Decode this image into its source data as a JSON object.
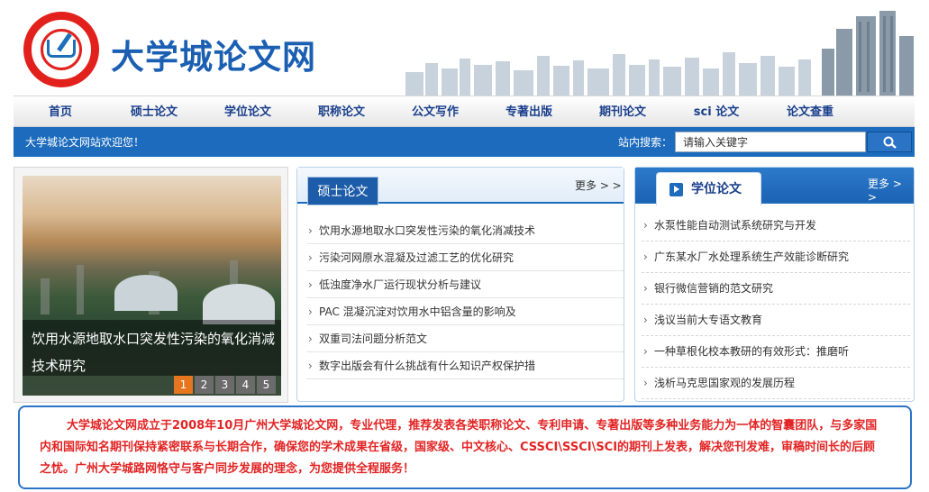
{
  "header": {
    "site_title": "大学城论文网",
    "logo_icon": "book-pen-logo-icon"
  },
  "nav": {
    "items": [
      "首页",
      "硕士论文",
      "学位论文",
      "职称论文",
      "公文写作",
      "专著出版",
      "期刊论文",
      "sci 论文",
      "论文查重"
    ]
  },
  "bar": {
    "welcome": "大学城论文网站欢迎您！",
    "search_label": "站内搜索：",
    "search_placeholder": "请输入关键字"
  },
  "slider": {
    "caption": "饮用水源地取水口突发性污染的氧化消减技术研究",
    "pages": [
      "1",
      "2",
      "3",
      "4",
      "5"
    ],
    "active_page": "1"
  },
  "box1": {
    "title": "硕士论文",
    "more": "更多 > >",
    "items": [
      "饮用水源地取水口突发性污染的氧化消减技术",
      "污染河网原水混凝及过滤工艺的优化研究",
      "低浊度净水厂运行现状分析与建议",
      "PAC 混凝沉淀对饮用水中铝含量的影响及",
      "双重司法问题分析范文",
      "数字出版会有什么挑战有什么知识产权保护措"
    ]
  },
  "box2": {
    "title": "学位论文",
    "more": "更多 > >",
    "items": [
      "水泵性能自动测试系统研究与开发",
      "广东某水厂水处理系统生产效能诊断研究",
      "银行微信营销的范文研究",
      "浅议当前大专语文教育",
      "一种草根化校本教研的有效形式：推磨听",
      "浅析马克思国家观的发展历程"
    ]
  },
  "intro": {
    "text": "大学城论文网成立于2008年10月广州大学城论文网，专业代理，推荐发表各类职称论文、专利申请、专著出版等多种业务能力为一体的智囊团队，与多家国内和国际知名期刊保持紧密联系与长期合作，确保您的学术成果在省级，国家级、中文核心、CSSCI\\SSCI\\SCI的期刊上发表，解决您刊发难，审稿时间长的后顾之忧。广州大学城路网恪守与客户同步发展的理念，为您提供全程服务！"
  },
  "colors": {
    "brand_blue": "#1c6bbd",
    "logo_red": "#e2211c",
    "intro_red": "#e22424",
    "active_page": "#e5761f"
  }
}
